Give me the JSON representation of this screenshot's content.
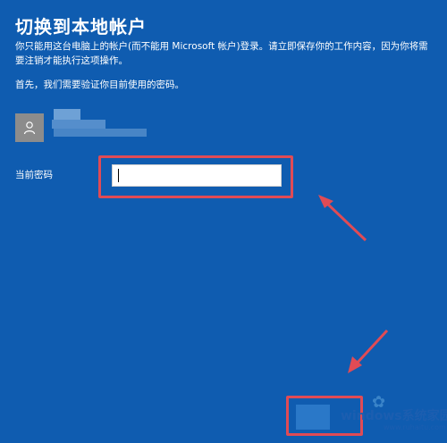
{
  "header": {
    "title": "切换到本地帐户",
    "description": "你只能用这台电脑上的帐户(而不能用 Microsoft 帐户)登录。请立即保存你的工作内容，因为你将需要注销才能执行这项操作。",
    "prompt": "首先，我们需要验证你目前使用的密码。"
  },
  "account": {
    "avatar_icon": "person-icon"
  },
  "password": {
    "label": "当前密码",
    "value": "",
    "placeholder": ""
  },
  "annotation": {
    "highlight_color": "#e04b55"
  },
  "watermark": {
    "main": "windows系统家园",
    "url": "www.ruhaitu.com"
  }
}
